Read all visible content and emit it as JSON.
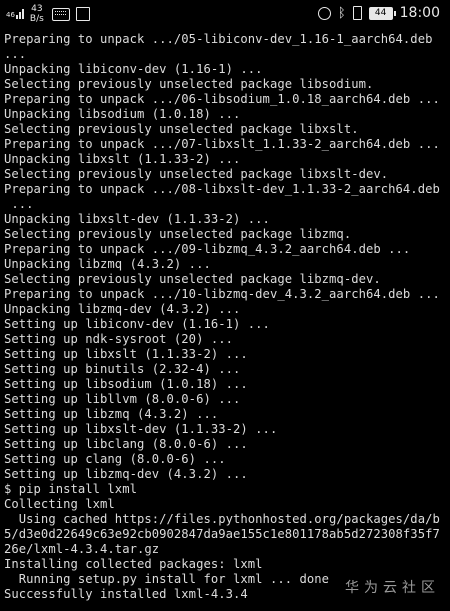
{
  "status_bar": {
    "signal": "46",
    "net_speed_value": "43",
    "net_speed_unit": "B/s",
    "time": "18:00",
    "battery": "44"
  },
  "terminal": {
    "lines": [
      "Preparing to unpack .../05-libiconv-dev_1.16-1_aarch64.deb",
      "...",
      "Unpacking libiconv-dev (1.16-1) ...",
      "Selecting previously unselected package libsodium.",
      "Preparing to unpack .../06-libsodium_1.0.18_aarch64.deb ...",
      "Unpacking libsodium (1.0.18) ...",
      "Selecting previously unselected package libxslt.",
      "Preparing to unpack .../07-libxslt_1.1.33-2_aarch64.deb ...",
      "Unpacking libxslt (1.1.33-2) ...",
      "Selecting previously unselected package libxslt-dev.",
      "Preparing to unpack .../08-libxslt-dev_1.1.33-2_aarch64.deb",
      " ...",
      "Unpacking libxslt-dev (1.1.33-2) ...",
      "Selecting previously unselected package libzmq.",
      "Preparing to unpack .../09-libzmq_4.3.2_aarch64.deb ...",
      "Unpacking libzmq (4.3.2) ...",
      "Selecting previously unselected package libzmq-dev.",
      "Preparing to unpack .../10-libzmq-dev_4.3.2_aarch64.deb ...",
      "Unpacking libzmq-dev (4.3.2) ...",
      "Setting up libiconv-dev (1.16-1) ...",
      "Setting up ndk-sysroot (20) ...",
      "Setting up libxslt (1.1.33-2) ...",
      "Setting up binutils (2.32-4) ...",
      "Setting up libsodium (1.0.18) ...",
      "Setting up libllvm (8.0.0-6) ...",
      "Setting up libzmq (4.3.2) ...",
      "Setting up libxslt-dev (1.1.33-2) ...",
      "Setting up libclang (8.0.0-6) ...",
      "Setting up clang (8.0.0-6) ...",
      "Setting up libzmq-dev (4.3.2) ...",
      "$ pip install lxml",
      "Collecting lxml",
      "  Using cached https://files.pythonhosted.org/packages/da/b",
      "5/d3e0d22649c63e92cb0902847da9ae155c1e801178ab5d272308f35f7",
      "26e/lxml-4.3.4.tar.gz",
      "Installing collected packages: lxml",
      "  Running setup.py install for lxml ... done",
      "Successfully installed lxml-4.3.4"
    ]
  },
  "watermark": "华为云社区"
}
